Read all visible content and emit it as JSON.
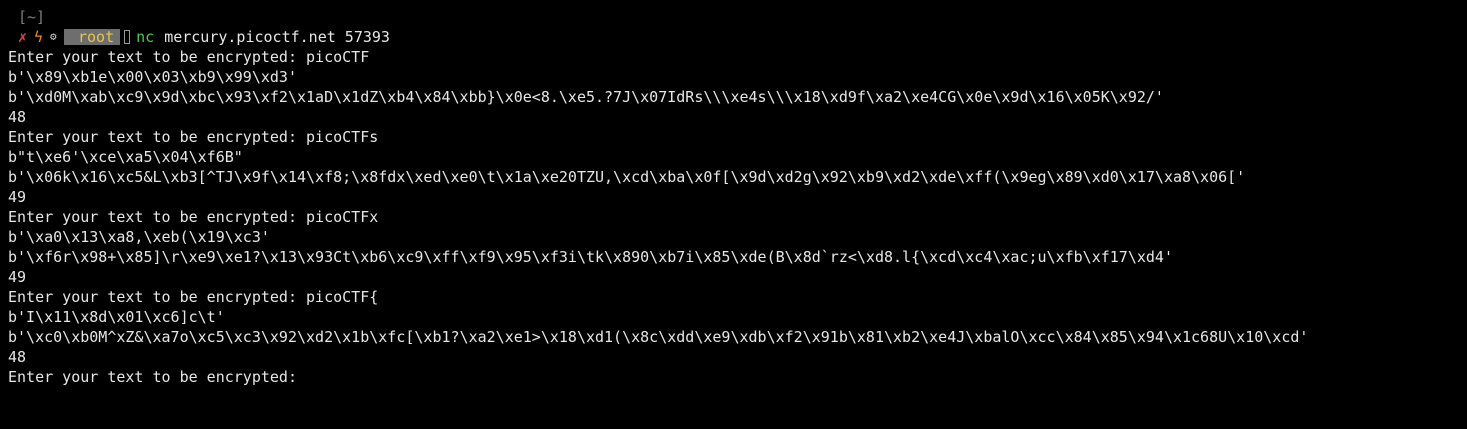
{
  "prompt": {
    "cwd": "[~]",
    "status_icon": "x-icon",
    "bolt_icon": "bolt-icon",
    "gear_icon": "gear-icon",
    "user": "root",
    "command": "nc",
    "args": "mercury.picoctf.net 57393"
  },
  "output": [
    "Enter your text to be encrypted: picoCTF",
    "b'\\x89\\xb1e\\x00\\x03\\xb9\\x99\\xd3'",
    "b'\\xd0M\\xab\\xc9\\x9d\\xbc\\x93\\xf2\\x1aD\\x1dZ\\xb4\\x84\\xbb}\\x0e<8.\\xe5.?7J\\x07IdRs\\\\\\xe4s\\\\\\x18\\xd9f\\xa2\\xe4CG\\x0e\\x9d\\x16\\x05K\\x92/'",
    "48",
    "Enter your text to be encrypted: picoCTFs",
    "b\"t\\xe6'\\xce\\xa5\\x04\\xf6B\"",
    "b'\\x06k\\x16\\xc5&L\\xb3[^TJ\\x9f\\x14\\xf8;\\x8fdx\\xed\\xe0\\t\\x1a\\xe20TZU,\\xcd\\xba\\x0f[\\x9d\\xd2g\\x92\\xb9\\xd2\\xde\\xff(\\x9eg\\x89\\xd0\\x17\\xa8\\x06['",
    "49",
    "Enter your text to be encrypted: picoCTFx",
    "b'\\xa0\\x13\\xa8,\\xeb(\\x19\\xc3'",
    "b'\\xf6r\\x98+\\x85]\\r\\xe9\\xe1?\\x13\\x93Ct\\xb6\\xc9\\xff\\xf9\\x95\\xf3i\\tk\\x890\\xb7i\\x85\\xde(B\\x8d`rz<\\xd8.l{\\xcd\\xc4\\xac;u\\xfb\\xf17\\xd4'",
    "49",
    "Enter your text to be encrypted: picoCTF{",
    "b'I\\x11\\x8d\\x01\\xc6]c\\t'",
    "b'\\xc0\\xb0M^xZ&\\xa7o\\xc5\\xc3\\x92\\xd2\\x1b\\xfc[\\xb1?\\xa2\\xe1>\\x18\\xd1(\\x8c\\xdd\\xe9\\xdb\\xf2\\x91b\\x81\\xb2\\xe4J\\xbalO\\xcc\\x84\\x85\\x94\\x1c68U\\x10\\xcd'",
    "48",
    "Enter your text to be encrypted: "
  ]
}
